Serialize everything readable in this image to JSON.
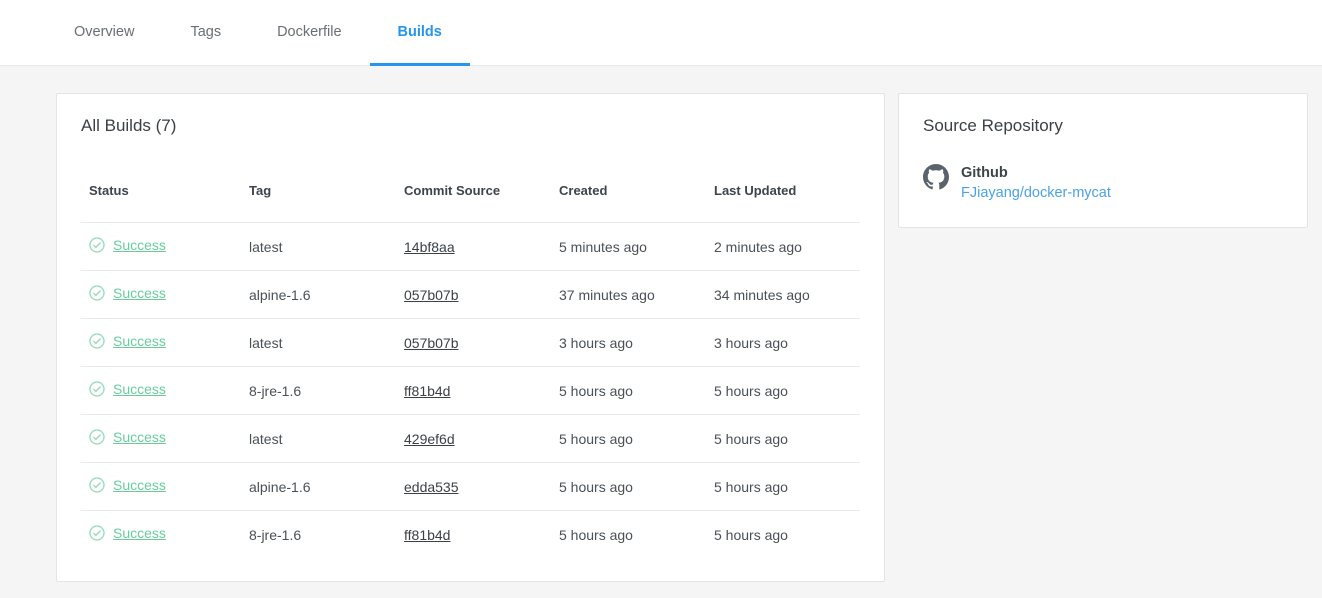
{
  "tabs": [
    {
      "label": "Overview",
      "active": false
    },
    {
      "label": "Tags",
      "active": false
    },
    {
      "label": "Dockerfile",
      "active": false
    },
    {
      "label": "Builds",
      "active": true
    }
  ],
  "builds_panel": {
    "title": "All Builds (7)",
    "columns": [
      "Status",
      "Tag",
      "Commit Source",
      "Created",
      "Last Updated"
    ],
    "rows": [
      {
        "status": "Success",
        "tag": "latest",
        "commit": "14bf8aa",
        "created": "5 minutes ago",
        "updated": "2 minutes ago"
      },
      {
        "status": "Success",
        "tag": "alpine-1.6",
        "commit": "057b07b",
        "created": "37 minutes ago",
        "updated": "34 minutes ago"
      },
      {
        "status": "Success",
        "tag": "latest",
        "commit": "057b07b",
        "created": "3 hours ago",
        "updated": "3 hours ago"
      },
      {
        "status": "Success",
        "tag": "8-jre-1.6",
        "commit": "ff81b4d",
        "created": "5 hours ago",
        "updated": "5 hours ago"
      },
      {
        "status": "Success",
        "tag": "latest",
        "commit": "429ef6d",
        "created": "5 hours ago",
        "updated": "5 hours ago"
      },
      {
        "status": "Success",
        "tag": "alpine-1.6",
        "commit": "edda535",
        "created": "5 hours ago",
        "updated": "5 hours ago"
      },
      {
        "status": "Success",
        "tag": "8-jre-1.6",
        "commit": "ff81b4d",
        "created": "5 hours ago",
        "updated": "5 hours ago"
      }
    ]
  },
  "source_repository": {
    "title": "Source Repository",
    "provider": "Github",
    "repo": "FJiayang/docker-mycat"
  },
  "icons": {
    "status": "check-circle-icon",
    "provider": "github-octocat-icon"
  },
  "colors": {
    "accent_blue": "#2496ed",
    "success_green": "#65cf9b",
    "success_icon_green": "#8edcb4",
    "link_blue": "#4ba2e2",
    "page_background": "#f5f5f6"
  }
}
